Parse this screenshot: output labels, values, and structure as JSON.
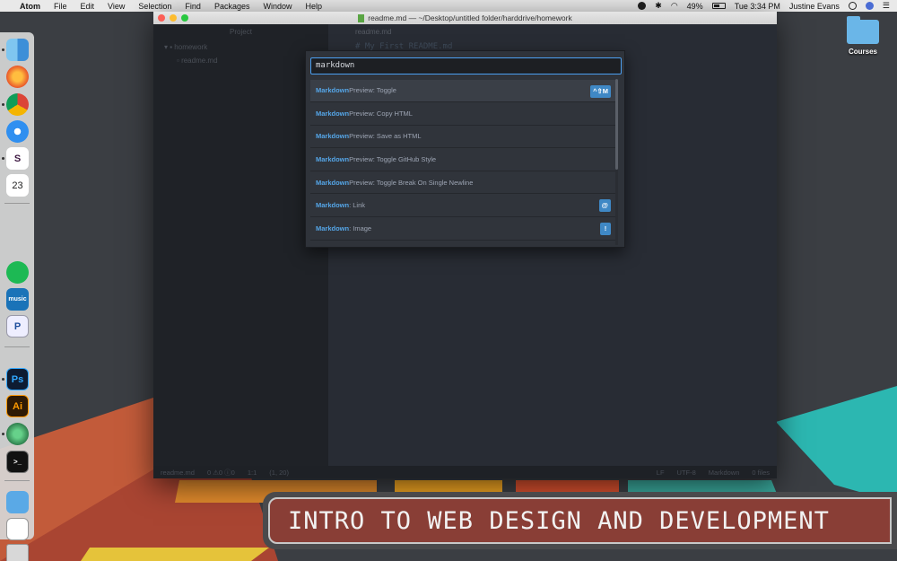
{
  "menubar": {
    "app": "Atom",
    "items": [
      "File",
      "Edit",
      "View",
      "Selection",
      "Find",
      "Packages",
      "Window",
      "Help"
    ],
    "battery": "49%",
    "clock": "Tue 3:34 PM",
    "user": "Justine Evans"
  },
  "window": {
    "title": "readme.md — ~/Desktop/untitled folder/harddrive/homework",
    "tree": {
      "header": "Project",
      "folder": "homework",
      "file": "readme.md"
    },
    "editor": {
      "tab": "readme.md",
      "line1": "# My First README.md"
    },
    "status": {
      "file": "readme.md",
      "diagnostics": "0 ⚠0 ⓘ0",
      "position": "1:1",
      "selection": "(1, 20)",
      "line_ending": "LF",
      "encoding": "UTF-8",
      "grammar": "Markdown",
      "files": "0 files"
    }
  },
  "palette": {
    "query": "markdown",
    "commands": [
      {
        "hl": "Markdown",
        "rest": " Preview: Toggle",
        "key": "^⇧M"
      },
      {
        "hl": "Markdown",
        "rest": " Preview: Copy HTML",
        "key": ""
      },
      {
        "hl": "Markdown",
        "rest": " Preview: Save as HTML",
        "key": ""
      },
      {
        "hl": "Markdown",
        "rest": " Preview: Toggle GitHub Style",
        "key": ""
      },
      {
        "hl": "Markdown",
        "rest": " Preview: Toggle Break On Single Newline",
        "key": ""
      },
      {
        "hl": "Markdown",
        "rest": ": Link",
        "key": "@"
      },
      {
        "hl": "Markdown",
        "rest": ": Image",
        "key": "!"
      }
    ]
  },
  "desktop": {
    "folder_label": "Courses",
    "banner": "INTRO TO WEB DESIGN AND DEVELOPMENT"
  },
  "dock": {
    "icons": [
      "finder-icon",
      "firefox-icon",
      "chrome-icon",
      "safari-icon",
      "slack-icon",
      "calendar-icon",
      "spotify-icon",
      "amazon-music-icon",
      "pandora-icon",
      "photoshop-icon",
      "illustrator-icon",
      "atom-icon",
      "terminal-icon",
      "applications-folder-icon",
      "document-icon",
      "trash-icon"
    ],
    "calendar_day": "23",
    "music_label": "music",
    "pandora_label": "P",
    "photoshop_label": "Ps",
    "illustrator_label": "Ai"
  }
}
